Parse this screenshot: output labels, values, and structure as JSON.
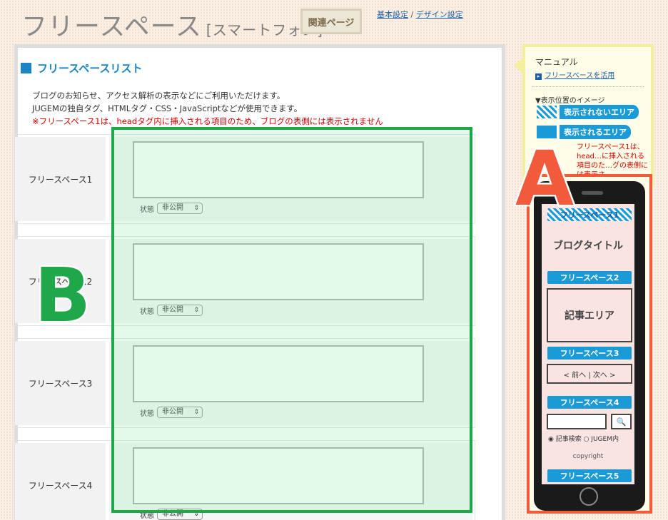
{
  "header": {
    "title": "フリースペース",
    "subtitle": "[スマートフォン]",
    "related": "関連ページ",
    "link1": "基本設定",
    "sep": " / ",
    "link2": "デザイン設定"
  },
  "panel": {
    "heading": "フリースペースリスト",
    "line1": "ブログのお知らせ、アクセス解析の表示などにご利用いただけます。",
    "line2": "JUGEMの独自タグ、HTMLタグ・CSS・JavaScriptなどが使用できます。",
    "warning": "※フリースペース1は、headタグ内に挿入される項目のため、ブログの表側には表示されません"
  },
  "rows": [
    {
      "label": "フリースペース1",
      "status_label": "状態",
      "status": "非公開"
    },
    {
      "label": "フリースペース2",
      "status_label": "状態",
      "status": "非公開"
    },
    {
      "label": "フリースペース3",
      "status_label": "状態",
      "status": "非公開"
    },
    {
      "label": "フリースペース4",
      "status_label": "状態",
      "status": "非公開"
    }
  ],
  "overlay": {
    "B": "B",
    "A": "A"
  },
  "manual": {
    "title": "マニュアル",
    "link": "フリースペースを活用",
    "image_title": "▼表示位置のイメージ",
    "not_shown": "表示されないエリア",
    "shown": "表示されるエリア",
    "warn": "フリースペース1は、head…に挿入される項目のた…グの表側には表示さ"
  },
  "phone": {
    "fs1": "フリースペース1",
    "blog_title": "ブログタイトル",
    "fs2": "フリースペース2",
    "article": "記事エリア",
    "fs3": "フリースペース3",
    "nav": "< 前へ | 次へ >",
    "fs4": "フリースペース4",
    "search_icon": "🔍",
    "radio": "◉ 記事検索 ○ JUGEM内",
    "copyright": "copyright",
    "fs5": "フリースペース5"
  }
}
